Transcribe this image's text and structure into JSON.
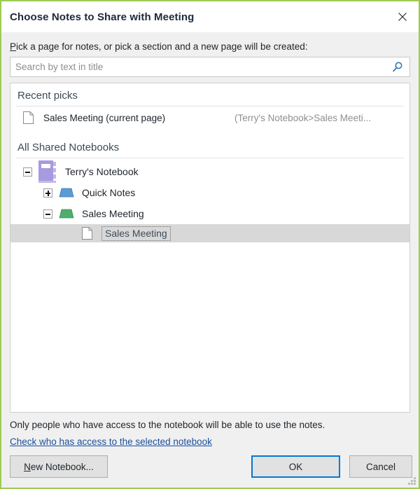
{
  "window": {
    "title": "Choose Notes to Share with Meeting",
    "close_icon": "close-icon",
    "border_color": "#9ecb53"
  },
  "prompt": {
    "accel": "P",
    "text": "ick a page for notes, or pick a section and a new page will be created:"
  },
  "search": {
    "value": "",
    "placeholder": "Search by text in title",
    "icon": "search-icon",
    "icon_color": "#2e75b6"
  },
  "recent": {
    "heading": "Recent picks",
    "items": [
      {
        "icon": "page-icon",
        "label": "Sales Meeting (current page)",
        "path": "(Terry's Notebook>Sales Meeti..."
      }
    ]
  },
  "tree": {
    "heading": "All Shared Notebooks",
    "nodes": [
      {
        "label": "Terry's Notebook",
        "icon": "notebook-icon",
        "icon_color": "#a89ade",
        "toggle": "minus",
        "level": 1,
        "selected": false
      },
      {
        "label": "Quick Notes",
        "icon": "section-icon",
        "icon_color": "#5b9bd5",
        "toggle": "plus",
        "level": 2,
        "selected": false
      },
      {
        "label": "Sales Meeting",
        "icon": "section-icon",
        "icon_color": "#4caf6d",
        "toggle": "minus",
        "level": 2,
        "selected": false
      },
      {
        "label": "Sales Meeting",
        "icon": "page-icon",
        "toggle": "none",
        "level": 3,
        "selected": true
      }
    ]
  },
  "footer": {
    "note": "Only people who have access to the notebook will be able to use the notes.",
    "link": "Check who has access to the selected notebook",
    "buttons": {
      "new_notebook_accel": "N",
      "new_notebook_rest": "ew Notebook...",
      "ok": "OK",
      "cancel": "Cancel",
      "ok_focus_color": "#0078d7"
    }
  }
}
